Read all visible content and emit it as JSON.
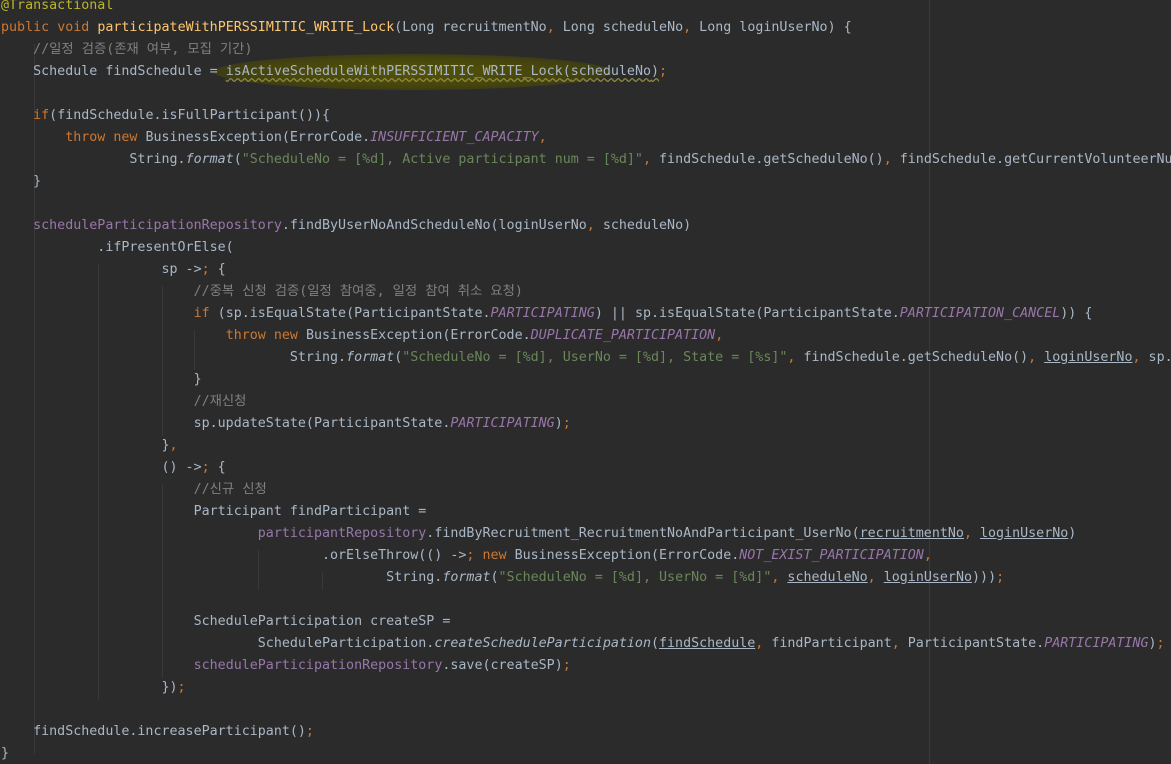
{
  "lines": [
    "@Transactional",
    "public void participateWithPERSSIMITIC_WRITE_Lock(Long recruitmentNo, Long scheduleNo, Long loginUserNo) {",
    "    //일정 검증(존재 여부, 모집 기간)",
    "    Schedule findSchedule = isActiveScheduleWithPERSSIMITIC_WRITE_Lock(scheduleNo);",
    "",
    "    if(findSchedule.isFullParticipant()){",
    "        throw new BusinessException(ErrorCode.INSUFFICIENT_CAPACITY,",
    "                String.format(\"ScheduleNo = [%d], Active participant num = [%d]\", findSchedule.getScheduleNo(), findSchedule.getCurrentVolunteerNum",
    "    }",
    "",
    "    scheduleParticipationRepository.findByUserNoAndScheduleNo(loginUserNo, scheduleNo)",
    "            .ifPresentOrElse(",
    "                    sp -> {",
    "                        //중복 신청 검증(일정 참여중, 일정 참여 취소 요청)",
    "                        if (sp.isEqualState(ParticipantState.PARTICIPATING) || sp.isEqualState(ParticipantState.PARTICIPATION_CANCEL)) {",
    "                            throw new BusinessException(ErrorCode.DUPLICATE_PARTICIPATION,",
    "                                    String.format(\"ScheduleNo = [%d], UserNo = [%d], State = [%s]\", findSchedule.getScheduleNo(), loginUserNo, sp.getState",
    "                        }",
    "                        //재신청",
    "                        sp.updateState(ParticipantState.PARTICIPATING);",
    "                    },",
    "                    () -> {",
    "                        //신규 신청",
    "                        Participant findParticipant =",
    "                                participantRepository.findByRecruitment_RecruitmentNoAndParticipant_UserNo(recruitmentNo, loginUserNo)",
    "                                        .orElseThrow(() -> new BusinessException(ErrorCode.NOT_EXIST_PARTICIPATION,",
    "                                                String.format(\"ScheduleNo = [%d], UserNo = [%d]\", scheduleNo, loginUserNo)));",
    "",
    "                        ScheduleParticipation createSP =",
    "                                ScheduleParticipation.createScheduleParticipation(findSchedule, findParticipant, ParticipantState.PARTICIPATING);",
    "                        scheduleParticipationRepository.save(createSP);",
    "                    });",
    "",
    "    findSchedule.increaseParticipant();",
    "}"
  ],
  "colors": {
    "background": "#2b2b2b",
    "default_text": "#a9b7c6",
    "keyword": "#cc7832",
    "annotation": "#bbb529",
    "method_declaration": "#ffc66d",
    "comment": "#808080",
    "field": "#9876aa",
    "string": "#6a8759"
  }
}
